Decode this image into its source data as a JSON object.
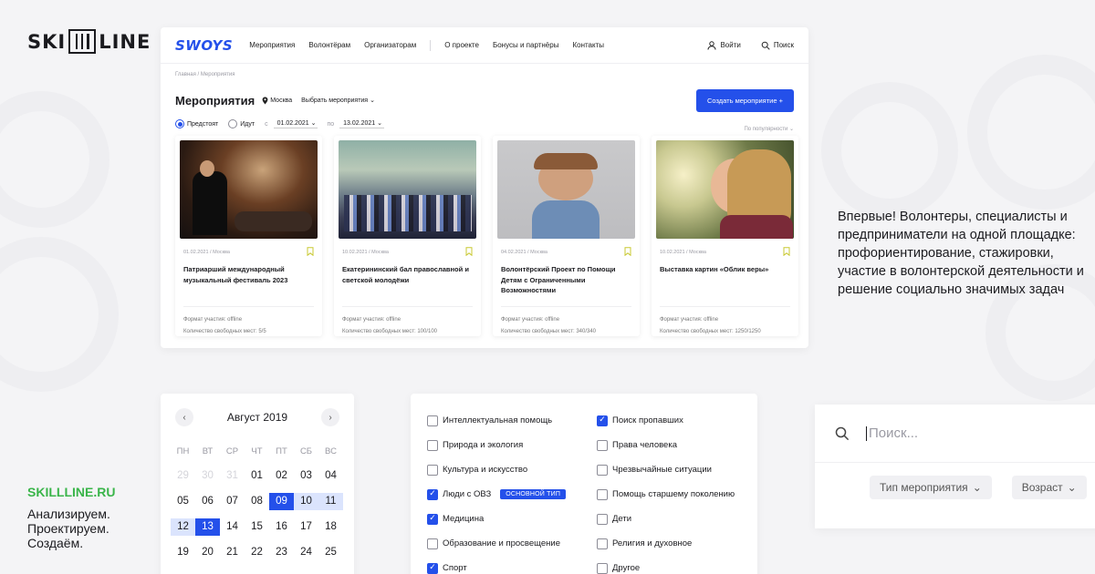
{
  "brand": {
    "logo_left": "SKI",
    "logo_right": "LINE",
    "site": "SKILLLINE.RU",
    "slogan": [
      "Анализируем.",
      "Проектируем.",
      "Создаём."
    ]
  },
  "site": {
    "logo": "SWOYS",
    "nav": [
      "Мероприятия",
      "Волонтёрам",
      "Организаторам"
    ],
    "nav2": [
      "О проекте",
      "Бонусы и партнёры",
      "Контакты"
    ],
    "login": "Войти",
    "search": "Поиск"
  },
  "page": {
    "breadcrumb": "Главная  /  Мероприятия",
    "title": "Мероприятия",
    "city": "Москва",
    "choose": "Выбрать мероприятия",
    "create_button": "Создать мероприятие +",
    "radio_upcoming": "Предстоят",
    "radio_ongoing": "Идут",
    "date_from_label": "с",
    "date_from": "01.02.2021",
    "date_to_label": "по",
    "date_to": "13.02.2021",
    "sort": "По популярности"
  },
  "events": [
    {
      "date": "01.02.2021  /  Москва",
      "title": "Патриарший международный музыкальный фестиваль 2023",
      "format": "Формат участия: offline",
      "places": "Количество свободных мест: 5/5"
    },
    {
      "date": "10.02.2021  /  Москва",
      "title": "Екатерининский бал православной и светской молодёжи",
      "format": "Формат участия: offline",
      "places": "Количество свободных мест: 100/100"
    },
    {
      "date": "04.02.2021  /  Москва",
      "title": "Волонтёрский Проект по Помощи Детям с Ограниченными Возможностями",
      "format": "Формат участия: offline",
      "places": "Количество свободных мест: 340/340"
    },
    {
      "date": "10.02.2021  /  Москва",
      "title": "Выставка картин «Облик веры»",
      "format": "Формат участия: offline",
      "places": "Количество свободных мест: 1250/1250"
    }
  ],
  "intro": "Впервые! Волонтеры, специалисты и предприниматели на одной площадке: профориентирование, стажировки, участие в волонтерской деятельности и решение социально значимых задач",
  "calendar": {
    "month": "Август 2019",
    "weekdays": [
      "ПН",
      "ВТ",
      "СР",
      "ЧТ",
      "ПТ",
      "СБ",
      "ВС"
    ],
    "days": [
      {
        "d": "29",
        "s": "muted"
      },
      {
        "d": "30",
        "s": "muted"
      },
      {
        "d": "31",
        "s": "muted"
      },
      {
        "d": "01",
        "s": ""
      },
      {
        "d": "02",
        "s": ""
      },
      {
        "d": "03",
        "s": ""
      },
      {
        "d": "04",
        "s": ""
      },
      {
        "d": "05",
        "s": ""
      },
      {
        "d": "06",
        "s": ""
      },
      {
        "d": "07",
        "s": ""
      },
      {
        "d": "08",
        "s": ""
      },
      {
        "d": "09",
        "s": "sel"
      },
      {
        "d": "10",
        "s": "range"
      },
      {
        "d": "11",
        "s": "range"
      },
      {
        "d": "12",
        "s": "range"
      },
      {
        "d": "13",
        "s": "sel"
      },
      {
        "d": "14",
        "s": ""
      },
      {
        "d": "15",
        "s": ""
      },
      {
        "d": "16",
        "s": ""
      },
      {
        "d": "17",
        "s": ""
      },
      {
        "d": "18",
        "s": ""
      },
      {
        "d": "19",
        "s": ""
      },
      {
        "d": "20",
        "s": ""
      },
      {
        "d": "21",
        "s": ""
      },
      {
        "d": "22",
        "s": ""
      },
      {
        "d": "23",
        "s": ""
      },
      {
        "d": "24",
        "s": ""
      },
      {
        "d": "25",
        "s": ""
      }
    ]
  },
  "categories": {
    "col1": [
      {
        "label": "Интеллектуальная помощь",
        "checked": false
      },
      {
        "label": "Природа и экология",
        "checked": false
      },
      {
        "label": "Культура и искусство",
        "checked": false
      },
      {
        "label": "Люди с ОВЗ",
        "checked": true,
        "badge": "ОСНОВНОЙ ТИП"
      },
      {
        "label": "Медицина",
        "checked": true
      },
      {
        "label": "Образование и просвещение",
        "checked": false
      },
      {
        "label": "Спорт",
        "checked": true
      }
    ],
    "col2": [
      {
        "label": "Поиск пропавших",
        "checked": true
      },
      {
        "label": "Права человека",
        "checked": false
      },
      {
        "label": "Чрезвычайные ситуации",
        "checked": false
      },
      {
        "label": "Помощь старшему поколению",
        "checked": false
      },
      {
        "label": "Дети",
        "checked": false
      },
      {
        "label": "Религия и духовное",
        "checked": false
      },
      {
        "label": "Другое",
        "checked": false
      }
    ]
  },
  "search_panel": {
    "placeholder": "Поиск...",
    "filter_type": "Тип мероприятия",
    "filter_age": "Возраст"
  },
  "colors": {
    "accent": "#2450ea",
    "brand_green": "#3ab54a"
  }
}
